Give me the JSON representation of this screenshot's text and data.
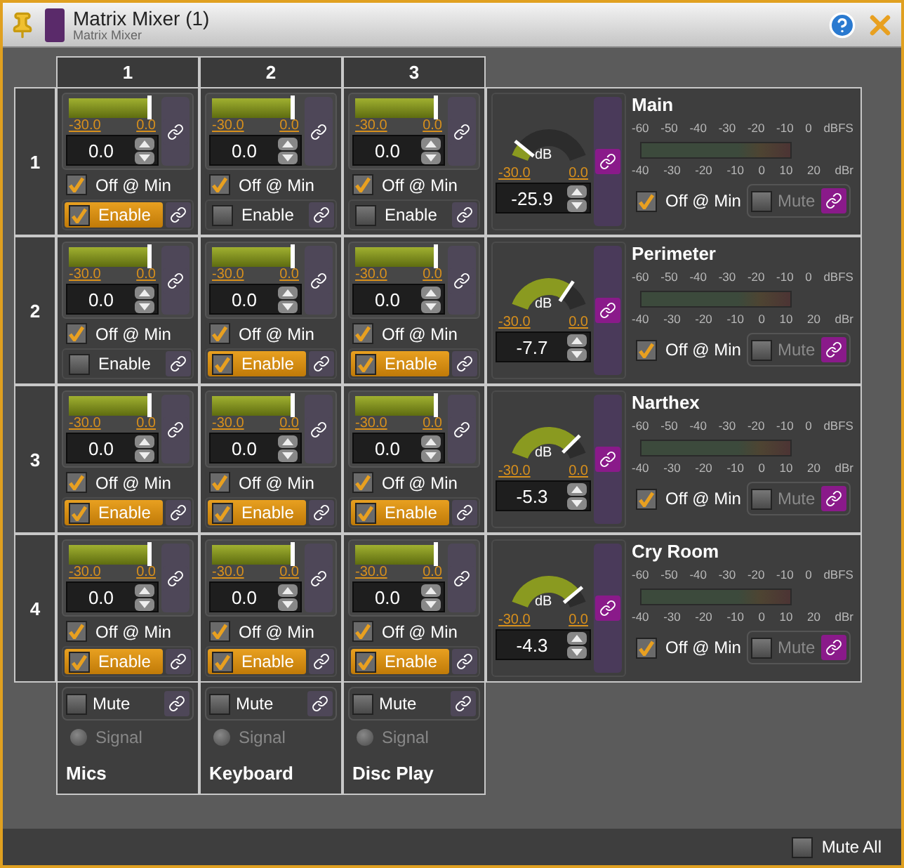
{
  "window": {
    "title": "Matrix Mixer (1)",
    "subtitle": "Matrix Mixer"
  },
  "columns": [
    {
      "label": "1"
    },
    {
      "label": "2"
    },
    {
      "label": "3"
    }
  ],
  "rows": [
    {
      "label": "1",
      "cells": [
        {
          "min": "-30.0",
          "max": "0.0",
          "level": 1,
          "value": "0.0",
          "off_label": "Off @ Min",
          "off_at_min": true,
          "enable_label": "Enable",
          "enabled": true
        },
        {
          "min": "-30.0",
          "max": "0.0",
          "level": 1,
          "value": "0.0",
          "off_label": "Off @ Min",
          "off_at_min": true,
          "enable_label": "Enable",
          "enabled": false
        },
        {
          "min": "-30.0",
          "max": "0.0",
          "level": 1,
          "value": "0.0",
          "off_label": "Off @ Min",
          "off_at_min": true,
          "enable_label": "Enable",
          "enabled": false
        }
      ],
      "output": {
        "name": "Main",
        "unit": "dB",
        "min": "-30.0",
        "max": "0.0",
        "level": 0.137,
        "value": "-25.9",
        "dbfs_ticks": [
          "-60",
          "-50",
          "-40",
          "-30",
          "-20",
          "-10",
          "0"
        ],
        "dbfs_unit": "dBFS",
        "dbr_ticks": [
          "-40",
          "-30",
          "-20",
          "-10",
          "0",
          "10",
          "20"
        ],
        "dbr_unit": "dBr",
        "off_label": "Off @ Min",
        "off_at_min": true,
        "mute_label": "Mute",
        "muted": false
      }
    },
    {
      "label": "2",
      "cells": [
        {
          "min": "-30.0",
          "max": "0.0",
          "level": 1,
          "value": "0.0",
          "off_label": "Off @ Min",
          "off_at_min": true,
          "enable_label": "Enable",
          "enabled": false
        },
        {
          "min": "-30.0",
          "max": "0.0",
          "level": 1,
          "value": "0.0",
          "off_label": "Off @ Min",
          "off_at_min": true,
          "enable_label": "Enable",
          "enabled": true
        },
        {
          "min": "-30.0",
          "max": "0.0",
          "level": 1,
          "value": "0.0",
          "off_label": "Off @ Min",
          "off_at_min": true,
          "enable_label": "Enable",
          "enabled": true
        }
      ],
      "output": {
        "name": "Perimeter",
        "unit": "dB",
        "min": "-30.0",
        "max": "0.0",
        "level": 0.743,
        "value": "-7.7",
        "dbfs_ticks": [
          "-60",
          "-50",
          "-40",
          "-30",
          "-20",
          "-10",
          "0"
        ],
        "dbfs_unit": "dBFS",
        "dbr_ticks": [
          "-40",
          "-30",
          "-20",
          "-10",
          "0",
          "10",
          "20"
        ],
        "dbr_unit": "dBr",
        "off_label": "Off @ Min",
        "off_at_min": true,
        "mute_label": "Mute",
        "muted": false
      }
    },
    {
      "label": "3",
      "cells": [
        {
          "min": "-30.0",
          "max": "0.0",
          "level": 1,
          "value": "0.0",
          "off_label": "Off @ Min",
          "off_at_min": true,
          "enable_label": "Enable",
          "enabled": true
        },
        {
          "min": "-30.0",
          "max": "0.0",
          "level": 1,
          "value": "0.0",
          "off_label": "Off @ Min",
          "off_at_min": true,
          "enable_label": "Enable",
          "enabled": true
        },
        {
          "min": "-30.0",
          "max": "0.0",
          "level": 1,
          "value": "0.0",
          "off_label": "Off @ Min",
          "off_at_min": true,
          "enable_label": "Enable",
          "enabled": true
        }
      ],
      "output": {
        "name": "Narthex",
        "unit": "dB",
        "min": "-30.0",
        "max": "0.0",
        "level": 0.823,
        "value": "-5.3",
        "dbfs_ticks": [
          "-60",
          "-50",
          "-40",
          "-30",
          "-20",
          "-10",
          "0"
        ],
        "dbfs_unit": "dBFS",
        "dbr_ticks": [
          "-40",
          "-30",
          "-20",
          "-10",
          "0",
          "10",
          "20"
        ],
        "dbr_unit": "dBr",
        "off_label": "Off @ Min",
        "off_at_min": true,
        "mute_label": "Mute",
        "muted": false
      }
    },
    {
      "label": "4",
      "cells": [
        {
          "min": "-30.0",
          "max": "0.0",
          "level": 1,
          "value": "0.0",
          "off_label": "Off @ Min",
          "off_at_min": true,
          "enable_label": "Enable",
          "enabled": true
        },
        {
          "min": "-30.0",
          "max": "0.0",
          "level": 1,
          "value": "0.0",
          "off_label": "Off @ Min",
          "off_at_min": true,
          "enable_label": "Enable",
          "enabled": true
        },
        {
          "min": "-30.0",
          "max": "0.0",
          "level": 1,
          "value": "0.0",
          "off_label": "Off @ Min",
          "off_at_min": true,
          "enable_label": "Enable",
          "enabled": true
        }
      ],
      "output": {
        "name": "Cry Room",
        "unit": "dB",
        "min": "-30.0",
        "max": "0.0",
        "level": 0.857,
        "value": "-4.3",
        "dbfs_ticks": [
          "-60",
          "-50",
          "-40",
          "-30",
          "-20",
          "-10",
          "0"
        ],
        "dbfs_unit": "dBFS",
        "dbr_ticks": [
          "-40",
          "-30",
          "-20",
          "-10",
          "0",
          "10",
          "20"
        ],
        "dbr_unit": "dBr",
        "off_label": "Off @ Min",
        "off_at_min": true,
        "mute_label": "Mute",
        "muted": false
      }
    }
  ],
  "inputs": [
    {
      "mute_label": "Mute",
      "muted": false,
      "signal_label": "Signal",
      "signal": false,
      "name": "Mics"
    },
    {
      "mute_label": "Mute",
      "muted": false,
      "signal_label": "Signal",
      "signal": false,
      "name": "Keyboard"
    },
    {
      "mute_label": "Mute",
      "muted": false,
      "signal_label": "Signal",
      "signal": false,
      "name": "Disc Play"
    }
  ],
  "mute_all": {
    "label": "Mute All",
    "checked": false
  }
}
